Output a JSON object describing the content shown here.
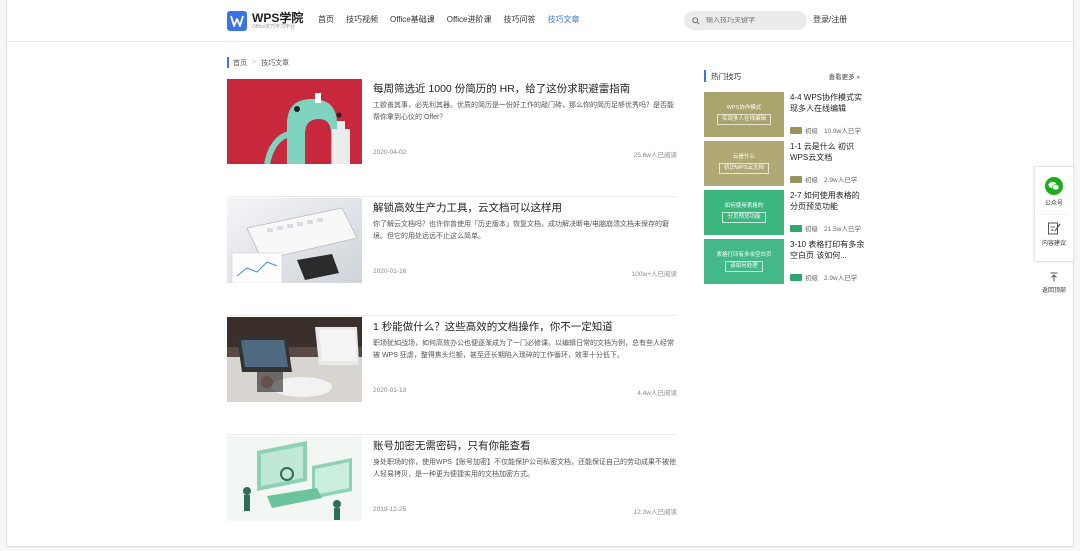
{
  "header": {
    "logo_title": "WPS学院",
    "logo_sub": "Office技巧学习平台",
    "nav": [
      {
        "label": "首页"
      },
      {
        "label": "技巧视频"
      },
      {
        "label": "Office基础课"
      },
      {
        "label": "Office进阶课"
      },
      {
        "label": "技巧问答"
      },
      {
        "label": "技巧文章"
      }
    ],
    "active_nav": "技巧文章",
    "search_placeholder": "输入技巧关键字",
    "login_label": "登录/注册"
  },
  "breadcrumb": {
    "home": "首页",
    "sep": ">",
    "current": "技巧文章"
  },
  "articles": [
    {
      "title": "每周筛选近 1000 份简历的 HR，给了这份求职避雷指南",
      "desc": "工欲善其事，必先利其器。优质的简历是一份好工作的敲门砖，那么你的简历足够优秀吗？是否能帮你拿到心仪的 Offer？",
      "date": "2020-04-02",
      "views": "25.6w人已阅读"
    },
    {
      "title": "解锁高效生产力工具，云文档可以这样用",
      "desc": "你了解云文档吗？也许你曾使用「历史版本」恢复文档，成功解决断电/电脑崩溃文档未保存的窘境。但它的用处远远不止这么简单。",
      "date": "2020-01-16",
      "views": "100w+人已阅读"
    },
    {
      "title": "1 秒能做什么？这些高效的文档操作，你不一定知道",
      "desc": "职场犹如战场，如何高效办公也便逐渐成为了一门必修课。以编辑日常的文档为例，总有些人经常被 WPS 狂虐，整得焦头烂额，甚至还长期陷入琐碎的工作循环，效率十分低下。",
      "date": "2020-01-13",
      "views": "4.4w人已阅读"
    },
    {
      "title": "账号加密无需密码，只有你能查看",
      "desc": "身处职场的你，使用WPS【账号加密】不仅能保护公司私密文档，还能保证自己的劳动成果不被他人轻易拷贝，是一种更为便捷实用的文档加密方式。",
      "date": "2019-12-25",
      "views": "12.3w人已阅读"
    }
  ],
  "sidebar": {
    "title": "热门技巧",
    "more": "查看更多 »",
    "tips": [
      {
        "title": "4-4 WPS协作模式实现多人在线编辑",
        "thumb_lines": [
          "WPS协作模式",
          "实现多人在线编辑"
        ],
        "level": "初级",
        "views": "10.9w人已学",
        "color": "#a9a36c",
        "level_color": "#9a935d"
      },
      {
        "title": "1-1 云是什么 初识WPS云文档",
        "thumb_lines": [
          "云是什么",
          "初识WPS云文档"
        ],
        "level": "初级",
        "views": "2.9w人已学",
        "color": "#b0a976",
        "level_color": "#9a935d"
      },
      {
        "title": "2-7 如何使用表格的分页预览功能",
        "thumb_lines": [
          "如何使用表格的",
          "分页预览功能"
        ],
        "level": "初级",
        "views": "21.5w人已学",
        "color": "#3bb67e",
        "level_color": "#2fa66f"
      },
      {
        "title": "3-10 表格打印有多余空白页 该如何...",
        "thumb_lines": [
          "表格打印有多余空白页",
          "该如何处理"
        ],
        "level": "初级",
        "views": "2.9w人已学",
        "color": "#45b887",
        "level_color": "#2fa66f"
      }
    ]
  },
  "float": {
    "wechat": "公众号",
    "suggest": "内容建议",
    "top": "返回顶部"
  },
  "colors": {
    "accent": "#3a73e8",
    "wechat": "#1aad19"
  }
}
